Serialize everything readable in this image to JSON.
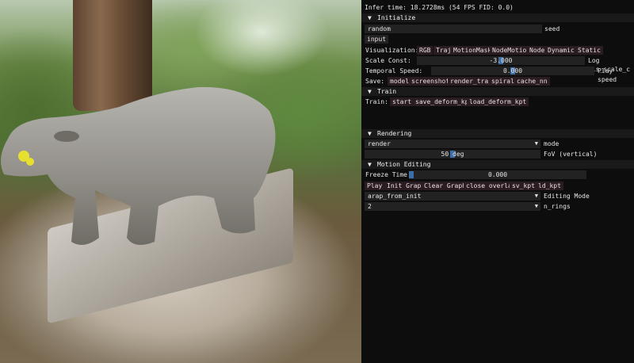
{
  "status": {
    "infer_time": "Infer time:  18.2728ms (54 FPS FID: 0.0)"
  },
  "sections": {
    "initialize": "Initialize",
    "train": "Train",
    "rendering": "Rendering",
    "motion_editing": "Motion Editing"
  },
  "initialize": {
    "seed_value": "random",
    "seed_label": "seed",
    "input_label": "input",
    "vis_label": "Visualization:",
    "vis_buttons": [
      "RGB",
      "Traj",
      "MotionMask",
      "NodeMotion",
      "Node",
      "Dynamic",
      "Static"
    ],
    "scale_label": "Scale Const:",
    "scale_value": "-3.000",
    "scale_fraction": 0.5,
    "log_label": "Log vis_scale_c",
    "temporal_label": "Temporal Speed:",
    "temporal_value": "0.000",
    "temporal_fraction": 0.5,
    "play_speed_label": "Play speed",
    "save_label": "Save:",
    "save_buttons": [
      "model",
      "screenshot",
      "render_traj",
      "spiral",
      "cache_nn"
    ]
  },
  "train": {
    "label": "Train:",
    "buttons": [
      "start",
      "save_deform_kpt",
      "load_deform_kpt"
    ]
  },
  "rendering": {
    "mode_value": "render",
    "mode_label": "mode",
    "fov_value": "50 deg",
    "fov_fraction": 0.5,
    "fov_label": "FoV (vertical)"
  },
  "motion": {
    "freeze_label": "Freeze Time:",
    "freeze_value": "0.000",
    "freeze_fraction": 0.0,
    "buttons": [
      "Play",
      "Init Graph",
      "Clear Graph",
      "close overlay",
      "sv_kpt",
      "ld_kpt"
    ],
    "editing_mode_value": "arap_from_init",
    "editing_mode_label": "Editing Mode",
    "n_rings_value": "2",
    "n_rings_label": "n_rings"
  },
  "icons": {
    "collapse": "triangle-down-icon",
    "dropdown": "triangle-down-icon"
  },
  "colors": {
    "panel_bg": "#0d0d0d",
    "button_bg": "#2a1d21",
    "field_bg": "#222222",
    "slider_grab": "#3d6ea8"
  }
}
